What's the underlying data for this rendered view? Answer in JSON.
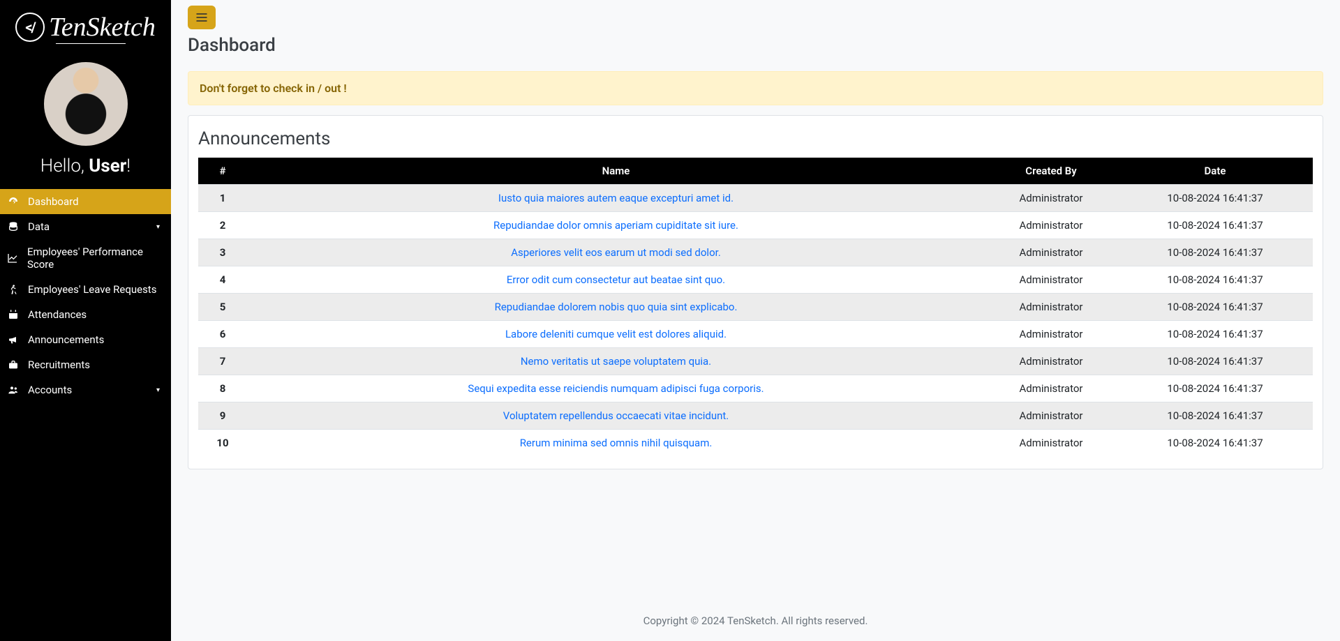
{
  "brand": {
    "name": "TenSketch",
    "mark": "</"
  },
  "greeting": {
    "prefix": "Hello, ",
    "user": "User",
    "suffix": "!"
  },
  "sidebar": {
    "items": [
      {
        "label": "Dashboard",
        "icon": "dashboard-icon",
        "active": true,
        "caret": false
      },
      {
        "label": "Data",
        "icon": "database-icon",
        "active": false,
        "caret": true
      },
      {
        "label": "Employees' Performance Score",
        "icon": "chart-line-icon",
        "active": false,
        "caret": false
      },
      {
        "label": "Employees' Leave Requests",
        "icon": "walking-icon",
        "active": false,
        "caret": false
      },
      {
        "label": "Attendances",
        "icon": "calendar-icon",
        "active": false,
        "caret": false
      },
      {
        "label": "Announcements",
        "icon": "bullhorn-icon",
        "active": false,
        "caret": false
      },
      {
        "label": "Recruitments",
        "icon": "briefcase-icon",
        "active": false,
        "caret": false
      },
      {
        "label": "Accounts",
        "icon": "users-icon",
        "active": false,
        "caret": true
      }
    ]
  },
  "page_title": "Dashboard",
  "alert_text": "Don't forget to check in / out !",
  "announcements": {
    "heading": "Announcements",
    "columns": [
      "#",
      "Name",
      "Created By",
      "Date"
    ],
    "rows": [
      {
        "n": 1,
        "name": "Iusto quia maiores autem eaque excepturi amet id.",
        "by": "Administrator",
        "date": "10-08-2024 16:41:37"
      },
      {
        "n": 2,
        "name": "Repudiandae dolor omnis aperiam cupiditate sit iure.",
        "by": "Administrator",
        "date": "10-08-2024 16:41:37"
      },
      {
        "n": 3,
        "name": "Asperiores velit eos earum ut modi sed dolor.",
        "by": "Administrator",
        "date": "10-08-2024 16:41:37"
      },
      {
        "n": 4,
        "name": "Error odit cum consectetur aut beatae sint quo.",
        "by": "Administrator",
        "date": "10-08-2024 16:41:37"
      },
      {
        "n": 5,
        "name": "Repudiandae dolorem nobis quo quia sint explicabo.",
        "by": "Administrator",
        "date": "10-08-2024 16:41:37"
      },
      {
        "n": 6,
        "name": "Labore deleniti cumque velit est dolores aliquid.",
        "by": "Administrator",
        "date": "10-08-2024 16:41:37"
      },
      {
        "n": 7,
        "name": "Nemo veritatis ut saepe voluptatem quia.",
        "by": "Administrator",
        "date": "10-08-2024 16:41:37"
      },
      {
        "n": 8,
        "name": "Sequi expedita esse reiciendis numquam adipisci fuga corporis.",
        "by": "Administrator",
        "date": "10-08-2024 16:41:37"
      },
      {
        "n": 9,
        "name": "Voluptatem repellendus occaecati vitae incidunt.",
        "by": "Administrator",
        "date": "10-08-2024 16:41:37"
      },
      {
        "n": 10,
        "name": "Rerum minima sed omnis nihil quisquam.",
        "by": "Administrator",
        "date": "10-08-2024 16:41:37"
      }
    ]
  },
  "footer": "Copyright © 2024 TenSketch. All rights reserved."
}
